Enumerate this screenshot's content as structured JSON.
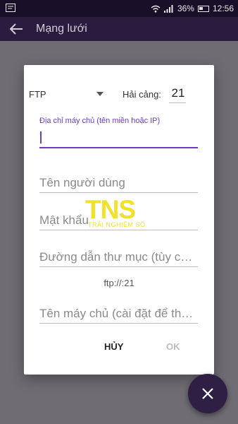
{
  "status_bar": {
    "battery_percent": "36%",
    "time": "12:56",
    "icons": [
      "notification-icon",
      "wifi-icon",
      "signal-icon",
      "battery-icon"
    ]
  },
  "app_bar": {
    "title": "Mạng lưới",
    "back_icon": "arrow-left-icon"
  },
  "dialog": {
    "protocol": "FTP",
    "port_label": "Hải cảng:",
    "port_value": "21",
    "host_caption": "Địa chỉ máy chủ (tên miền hoặc IP)",
    "host_value": "",
    "username_placeholder": "Tên người dùng",
    "password_placeholder": "Mật khẩu",
    "path_placeholder": "Đường dẫn thư mục (tùy chọn)",
    "url_preview": "ftp://:21",
    "display_name_placeholder": "Tên máy chủ (cài đặt để thuận tiện)",
    "cancel_label": "HỦY",
    "ok_label": "OK"
  },
  "watermark": {
    "letters": "TNS",
    "subtitle": "TRẢI NGHIỆM SỐ"
  },
  "fab": {
    "icon": "close-icon"
  },
  "colors": {
    "accent": "#6a3dc2",
    "app_bar": "#2b1b3f",
    "status_bar": "#1a0f28",
    "fab": "#2f1f44"
  }
}
